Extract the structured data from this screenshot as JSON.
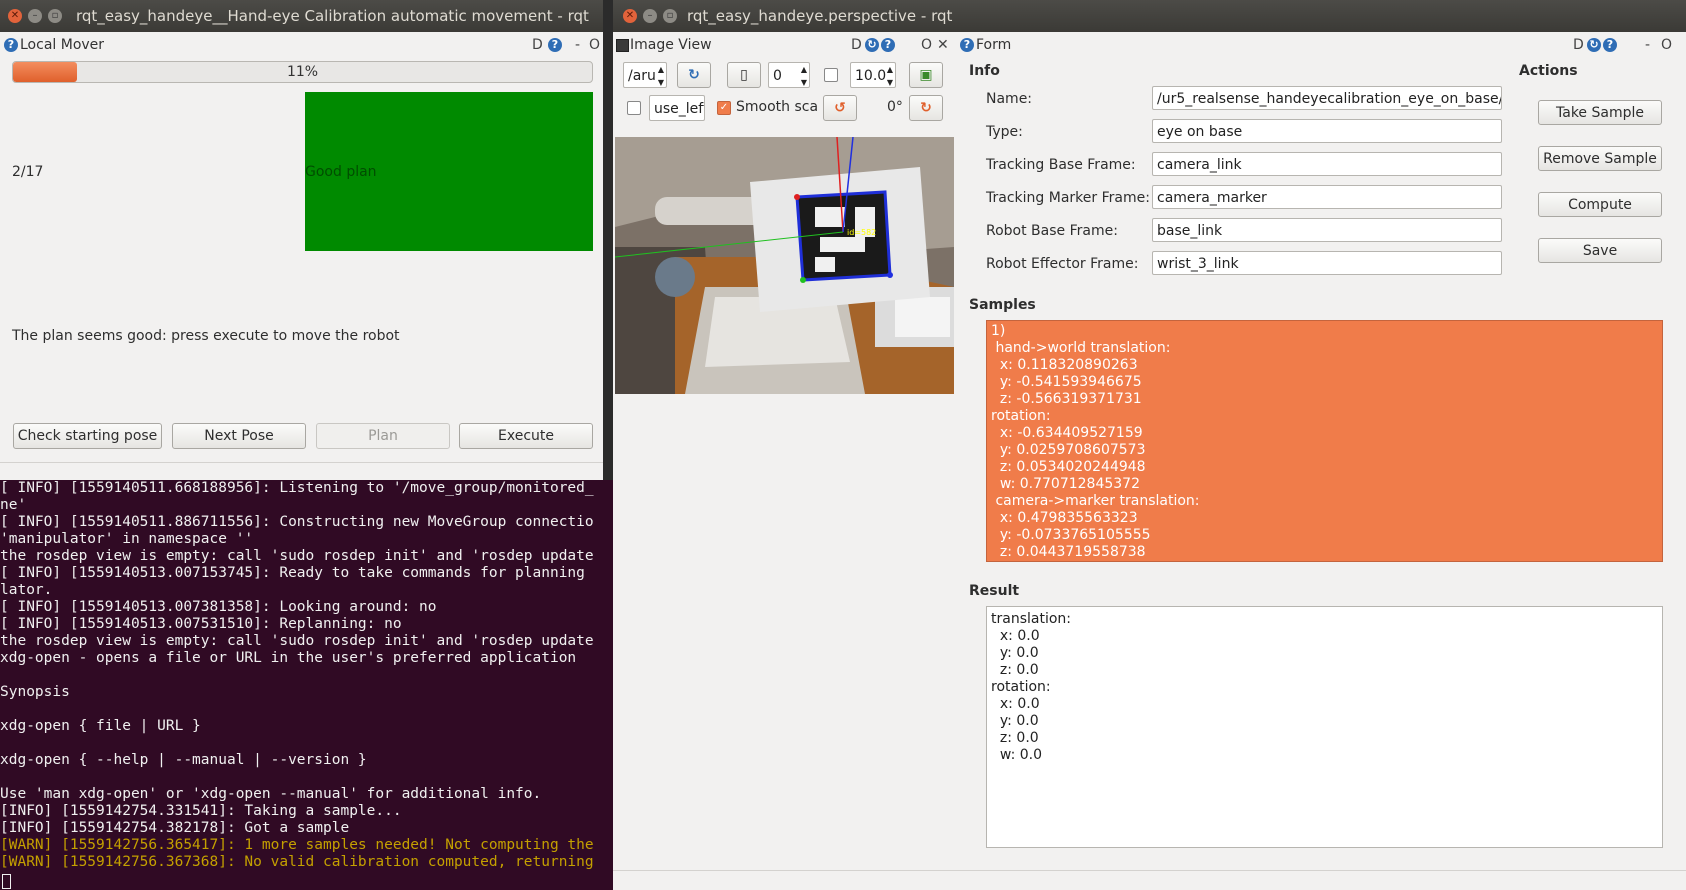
{
  "left_window": {
    "title": "rqt_easy_handeye__Hand-eye Calibration automatic movement - rqt",
    "dock_title": "Local Mover",
    "dock_flags": "D",
    "dock_minimize": "-",
    "dock_float": "O",
    "progress": {
      "value": 0.11,
      "label": "11%"
    },
    "pose_counter": "2/17",
    "plan_indicator_text": "Good plan",
    "plan_indicator_color": "#008a00",
    "status_message": "The plan seems good: press execute to move the robot",
    "buttons": {
      "check_starting_pose": "Check starting pose",
      "next_pose": "Next Pose",
      "plan": "Plan",
      "execute": "Execute"
    }
  },
  "terminal": {
    "lines": [
      {
        "text": "[ INFO] [1559140511.668188956]: Listening to '/move_group/monitored_",
        "level": "info"
      },
      {
        "text": "ne'",
        "level": "info"
      },
      {
        "text": "[ INFO] [1559140511.886711556]: Constructing new MoveGroup connectio",
        "level": "info"
      },
      {
        "text": "'manipulator' in namespace ''",
        "level": "info"
      },
      {
        "text": "the rosdep view is empty: call 'sudo rosdep init' and 'rosdep update",
        "level": "info"
      },
      {
        "text": "[ INFO] [1559140513.007153745]: Ready to take commands for planning",
        "level": "info"
      },
      {
        "text": "lator.",
        "level": "info"
      },
      {
        "text": "[ INFO] [1559140513.007381358]: Looking around: no",
        "level": "info"
      },
      {
        "text": "[ INFO] [1559140513.007531510]: Replanning: no",
        "level": "info"
      },
      {
        "text": "the rosdep view is empty: call 'sudo rosdep init' and 'rosdep update",
        "level": "info"
      },
      {
        "text": "xdg-open - opens a file or URL in the user's preferred application",
        "level": "info"
      },
      {
        "text": "",
        "level": "info"
      },
      {
        "text": "Synopsis",
        "level": "info"
      },
      {
        "text": "",
        "level": "info"
      },
      {
        "text": "xdg-open { file | URL }",
        "level": "info"
      },
      {
        "text": "",
        "level": "info"
      },
      {
        "text": "xdg-open { --help | --manual | --version }",
        "level": "info"
      },
      {
        "text": "",
        "level": "info"
      },
      {
        "text": "Use 'man xdg-open' or 'xdg-open --manual' for additional info.",
        "level": "info"
      },
      {
        "text": "[INFO] [1559142754.331541]: Taking a sample...",
        "level": "info"
      },
      {
        "text": "[INFO] [1559142754.382178]: Got a sample",
        "level": "info"
      },
      {
        "text": "[WARN] [1559142756.365417]: 1 more samples needed! Not computing the",
        "level": "warn"
      },
      {
        "text": "[WARN] [1559142756.367368]: No valid calibration computed, returning",
        "level": "warn"
      }
    ]
  },
  "right_window": {
    "title": "rqt_easy_handeye.perspective - rqt",
    "image_view": {
      "dock_title": "Image View",
      "dock_flags": "D",
      "dock_float": "O",
      "topic": "/aru",
      "refresh_icon": "refresh-icon",
      "zoom_value": "0",
      "max_value": "10.0",
      "mouse_topic": "use_left",
      "smooth_label": "Smooth sca",
      "smooth_checked": true,
      "rotation": "0°",
      "marker_label": "id=582"
    },
    "form": {
      "dock_title": "Form",
      "dock_flags": "D",
      "dock_float": "O",
      "info_heading": "Info",
      "actions_heading": "Actions",
      "fields": [
        {
          "label": "Name:",
          "value": "/ur5_realsense_handeyecalibration_eye_on_base/"
        },
        {
          "label": "Type:",
          "value": "eye on base"
        },
        {
          "label": "Tracking Base Frame:",
          "value": "camera_link"
        },
        {
          "label": "Tracking Marker Frame:",
          "value": "camera_marker"
        },
        {
          "label": "Robot Base Frame:",
          "value": "base_link"
        },
        {
          "label": "Robot Effector Frame:",
          "value": "wrist_3_link"
        }
      ],
      "actions": {
        "take_sample": "Take Sample",
        "remove_sample": "Remove Sample",
        "compute": "Compute",
        "save": "Save"
      },
      "samples_heading": "Samples",
      "samples_color": "#f07c4a",
      "samples_text": "1)\n hand->world translation:\n  x: 0.118320890263\n  y: -0.541593946675\n  z: -0.566319371731\nrotation:\n  x: -0.634409527159\n  y: 0.0259708607573\n  z: 0.0534020244948\n  w: 0.770712845372\n camera->marker translation:\n  x: 0.479835563323\n  y: -0.0733765105555\n  z: 0.0443719558738",
      "result_heading": "Result",
      "result_text": "translation:\n  x: 0.0\n  y: 0.0\n  z: 0.0\nrotation:\n  x: 0.0\n  y: 0.0\n  z: 0.0\n  w: 0.0"
    }
  }
}
